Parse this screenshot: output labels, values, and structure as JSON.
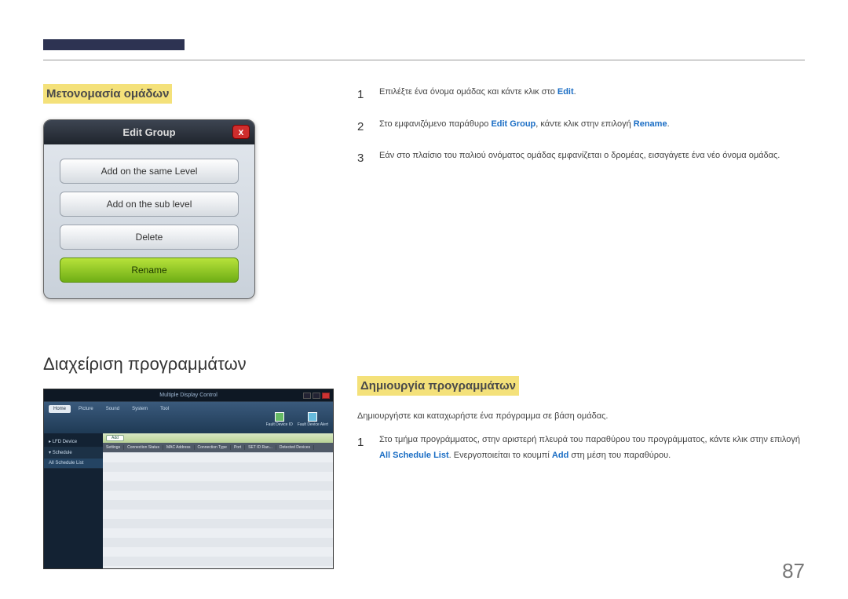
{
  "section1_title": "Μετονομασία ομάδων",
  "popup": {
    "title": "Edit Group",
    "close": "x",
    "btn1": "Add on the same Level",
    "btn2": "Add on the sub level",
    "btn3": "Delete",
    "btn4": "Rename"
  },
  "steps1": [
    {
      "num": "1",
      "pre": "Επιλέξτε ένα όνομα ομάδας και κάντε κλικ στο ",
      "kw1": "Edit",
      "post": "."
    },
    {
      "num": "2",
      "pre": "Στο εμφανιζόμενο παράθυρο ",
      "kw1": "Edit Group",
      "mid": ", κάντε κλικ στην επιλογή ",
      "kw2": "Rename",
      "post": "."
    },
    {
      "num": "3",
      "pre": "Εάν στο πλαίσιο του παλιού ονόματος ομάδας εμφανίζεται ο δρομέας, εισαγάγετε ένα νέο όνομα ομάδας."
    }
  ],
  "h2": "Διαχείριση προγραμμάτων",
  "section2_title": "Δημιουργία προγραμμάτων",
  "intro": "Δημιουργήστε και καταχωρήστε ένα πρόγραμμα σε βάση ομάδας.",
  "steps2": [
    {
      "num": "1",
      "pre": "Στο τμήμα προγράμματος, στην αριστερή πλευρά του παραθύρου του προγράμματος, κάντε κλικ στην επιλογή ",
      "kw1": "All Schedule List",
      "mid": ". Ενεργοποιείται το κουμπί ",
      "kw2": "Add",
      "post": " στη μέση του παραθύρου."
    }
  ],
  "mdc": {
    "title": "Multiple Display Control",
    "tabs": [
      "Home",
      "Picture",
      "Sound",
      "System",
      "Tool"
    ],
    "iconlabels": [
      "Fault Device ID",
      "Fault Device Alert"
    ],
    "side": [
      "LFD Device",
      "Schedule",
      "All Schedule List"
    ],
    "add": "Add",
    "headers": [
      "Settings",
      "Connection Status",
      "MAC Address",
      "Connection Type",
      "Port",
      "SET ID Ran...",
      "Detected Devices"
    ]
  },
  "page_number": "87"
}
